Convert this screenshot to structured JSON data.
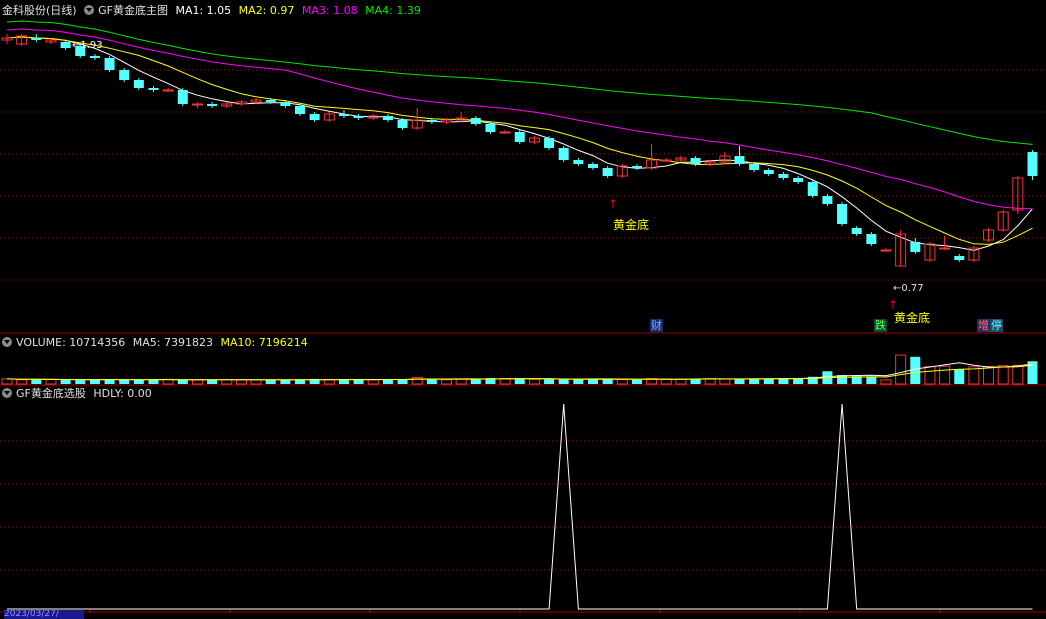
{
  "colors": {
    "bg": "#000000",
    "up": "#ff3232",
    "down": "#54ffff",
    "ma1": "#ffffff",
    "ma2": "#ffff00",
    "ma3": "#ff00ff",
    "ma4": "#00e600",
    "signal": "#ffffff",
    "grid": "#8b1a1a",
    "arrow": "#ff0000",
    "gold_text": "#ffff00"
  },
  "main_panel": {
    "stock": "金科股份(日线)",
    "indicator": "GF黄金底主图",
    "ma1_label": "MA1: 1.05",
    "ma2_label": "MA2: 0.97",
    "ma3_label": "MA3: 1.08",
    "ma4_label": "MA4: 1.39",
    "high_marker": "←1.93",
    "low_marker": "←0.77",
    "signal_text_1": "黄金底",
    "signal_text_2": "黄金底",
    "tags": {
      "cai": "财",
      "die": "跌",
      "zeng": "增",
      "ting": "停"
    }
  },
  "volume_panel": {
    "volume_label": "VOLUME: 10714356",
    "ma5_label": "MA5: 7391823",
    "ma10_label": "MA10: 7196214"
  },
  "signal_panel": {
    "title": "GF黄金底选股",
    "hdly_label": "HDLY: 0.00"
  },
  "date_label": "2023/03/27/",
  "chart_data": [
    {
      "type": "candlestick",
      "title": "GF黄金底主图",
      "ylim": [
        0.6,
        2.0
      ],
      "candles": [
        [
          1.9,
          1.91,
          1.93,
          1.88
        ],
        [
          1.88,
          1.92,
          1.93,
          1.87
        ],
        [
          1.91,
          1.9,
          1.93,
          1.89
        ],
        [
          1.89,
          1.9,
          1.91,
          1.88
        ],
        [
          1.89,
          1.86,
          1.9,
          1.85
        ],
        [
          1.87,
          1.82,
          1.88,
          1.81
        ],
        [
          1.82,
          1.81,
          1.83,
          1.8
        ],
        [
          1.81,
          1.75,
          1.82,
          1.74
        ],
        [
          1.75,
          1.7,
          1.76,
          1.69
        ],
        [
          1.7,
          1.66,
          1.71,
          1.65
        ],
        [
          1.66,
          1.65,
          1.67,
          1.64
        ],
        [
          1.65,
          1.65,
          1.66,
          1.64
        ],
        [
          1.65,
          1.58,
          1.66,
          1.57
        ],
        [
          1.58,
          1.58,
          1.59,
          1.56
        ],
        [
          1.58,
          1.57,
          1.59,
          1.56
        ],
        [
          1.57,
          1.58,
          1.59,
          1.56
        ],
        [
          1.58,
          1.59,
          1.6,
          1.57
        ],
        [
          1.59,
          1.6,
          1.61,
          1.58
        ],
        [
          1.6,
          1.59,
          1.61,
          1.58
        ],
        [
          1.59,
          1.57,
          1.6,
          1.56
        ],
        [
          1.57,
          1.53,
          1.58,
          1.52
        ],
        [
          1.53,
          1.5,
          1.54,
          1.49
        ],
        [
          1.5,
          1.53,
          1.54,
          1.49
        ],
        [
          1.53,
          1.52,
          1.55,
          1.51
        ],
        [
          1.52,
          1.51,
          1.53,
          1.5
        ],
        [
          1.51,
          1.52,
          1.53,
          1.5
        ],
        [
          1.52,
          1.5,
          1.53,
          1.49
        ],
        [
          1.5,
          1.46,
          1.51,
          1.45
        ],
        [
          1.46,
          1.5,
          1.56,
          1.45
        ],
        [
          1.5,
          1.49,
          1.51,
          1.48
        ],
        [
          1.49,
          1.5,
          1.51,
          1.48
        ],
        [
          1.5,
          1.51,
          1.54,
          1.49
        ],
        [
          1.51,
          1.48,
          1.52,
          1.47
        ],
        [
          1.48,
          1.44,
          1.49,
          1.43
        ],
        [
          1.44,
          1.44,
          1.45,
          1.43
        ],
        [
          1.44,
          1.39,
          1.45,
          1.38
        ],
        [
          1.39,
          1.41,
          1.42,
          1.38
        ],
        [
          1.41,
          1.36,
          1.42,
          1.35
        ],
        [
          1.36,
          1.3,
          1.37,
          1.29
        ],
        [
          1.3,
          1.28,
          1.31,
          1.27
        ],
        [
          1.28,
          1.26,
          1.29,
          1.25
        ],
        [
          1.26,
          1.22,
          1.27,
          1.21
        ],
        [
          1.22,
          1.27,
          1.28,
          1.21
        ],
        [
          1.27,
          1.26,
          1.28,
          1.25
        ],
        [
          1.26,
          1.3,
          1.38,
          1.25
        ],
        [
          1.3,
          1.3,
          1.31,
          1.29
        ],
        [
          1.3,
          1.31,
          1.32,
          1.29
        ],
        [
          1.31,
          1.28,
          1.32,
          1.27
        ],
        [
          1.28,
          1.29,
          1.3,
          1.27
        ],
        [
          1.29,
          1.32,
          1.34,
          1.28
        ],
        [
          1.32,
          1.28,
          1.37,
          1.27
        ],
        [
          1.28,
          1.25,
          1.29,
          1.24
        ],
        [
          1.25,
          1.23,
          1.26,
          1.22
        ],
        [
          1.23,
          1.21,
          1.24,
          1.2
        ],
        [
          1.21,
          1.19,
          1.22,
          1.18
        ],
        [
          1.19,
          1.12,
          1.2,
          1.11
        ],
        [
          1.12,
          1.08,
          1.13,
          1.07
        ],
        [
          1.08,
          0.98,
          1.09,
          0.97
        ],
        [
          0.96,
          0.93,
          0.97,
          0.92
        ],
        [
          0.93,
          0.88,
          0.94,
          0.87
        ],
        [
          0.85,
          0.85,
          0.86,
          0.84
        ],
        [
          0.77,
          0.93,
          0.95,
          0.77
        ],
        [
          0.89,
          0.84,
          0.91,
          0.83
        ],
        [
          0.8,
          0.88,
          0.89,
          0.79
        ],
        [
          0.86,
          0.86,
          0.92,
          0.85
        ],
        [
          0.82,
          0.8,
          0.83,
          0.79
        ],
        [
          0.8,
          0.86,
          0.87,
          0.79
        ],
        [
          0.9,
          0.95,
          0.96,
          0.89
        ],
        [
          0.95,
          1.04,
          1.05,
          0.94
        ],
        [
          1.05,
          1.21,
          1.22,
          1.03
        ],
        [
          1.34,
          1.22,
          1.35,
          1.2
        ]
      ],
      "ma_levels": {
        "MA1": 1.05,
        "MA2": 0.97,
        "MA3": 1.08,
        "MA4": 1.39
      },
      "annotations": [
        {
          "text": "黄金底",
          "index": 38
        },
        {
          "text": "黄金底",
          "index": 57
        },
        {
          "text": "←1.93",
          "index": 2
        },
        {
          "text": "←0.77",
          "index": 57
        }
      ]
    },
    {
      "type": "bar",
      "title": "VOLUME",
      "values": [
        2.4,
        2.0,
        2.2,
        2.1,
        2.0,
        1.8,
        2.1,
        2.2,
        1.9,
        2.0,
        2.1,
        2.2,
        2.0,
        1.9,
        2.0,
        2.1,
        2.0,
        1.9,
        1.8,
        1.9,
        2.2,
        2.4,
        2.0,
        2.0,
        2.1,
        2.0,
        2.2,
        2.3,
        3.1,
        2.1,
        2.0,
        2.4,
        2.5,
        2.8,
        2.6,
        2.4,
        2.2,
        2.3,
        2.1,
        2.2,
        2.5,
        2.3,
        2.1,
        2.0,
        2.6,
        2.4,
        2.3,
        2.4,
        2.5,
        2.4,
        2.5,
        2.4,
        2.6,
        2.7,
        2.8,
        3.4,
        6.0,
        4.2,
        3.7,
        3.4,
        1.9,
        13.6,
        12.8,
        8.2,
        8.4,
        6.8,
        8.1,
        8.2,
        8.6,
        8.8,
        10.7
      ],
      "ylim": [
        0,
        16
      ]
    },
    {
      "type": "line",
      "title": "GF黄金底选股",
      "values": [
        0,
        0,
        0,
        0,
        0,
        0,
        0,
        0,
        0,
        0,
        0,
        0,
        0,
        0,
        0,
        0,
        0,
        0,
        0,
        0,
        0,
        0,
        0,
        0,
        0,
        0,
        0,
        0,
        0,
        0,
        0,
        0,
        0,
        0,
        0,
        0,
        0,
        0,
        1,
        0,
        0,
        0,
        0,
        0,
        0,
        0,
        0,
        0,
        0,
        0,
        0,
        0,
        0,
        0,
        0,
        0,
        0,
        1,
        0,
        0,
        0,
        0,
        0,
        0,
        0,
        0,
        0,
        0,
        0,
        0,
        0
      ],
      "ylim": [
        0,
        1
      ]
    }
  ]
}
